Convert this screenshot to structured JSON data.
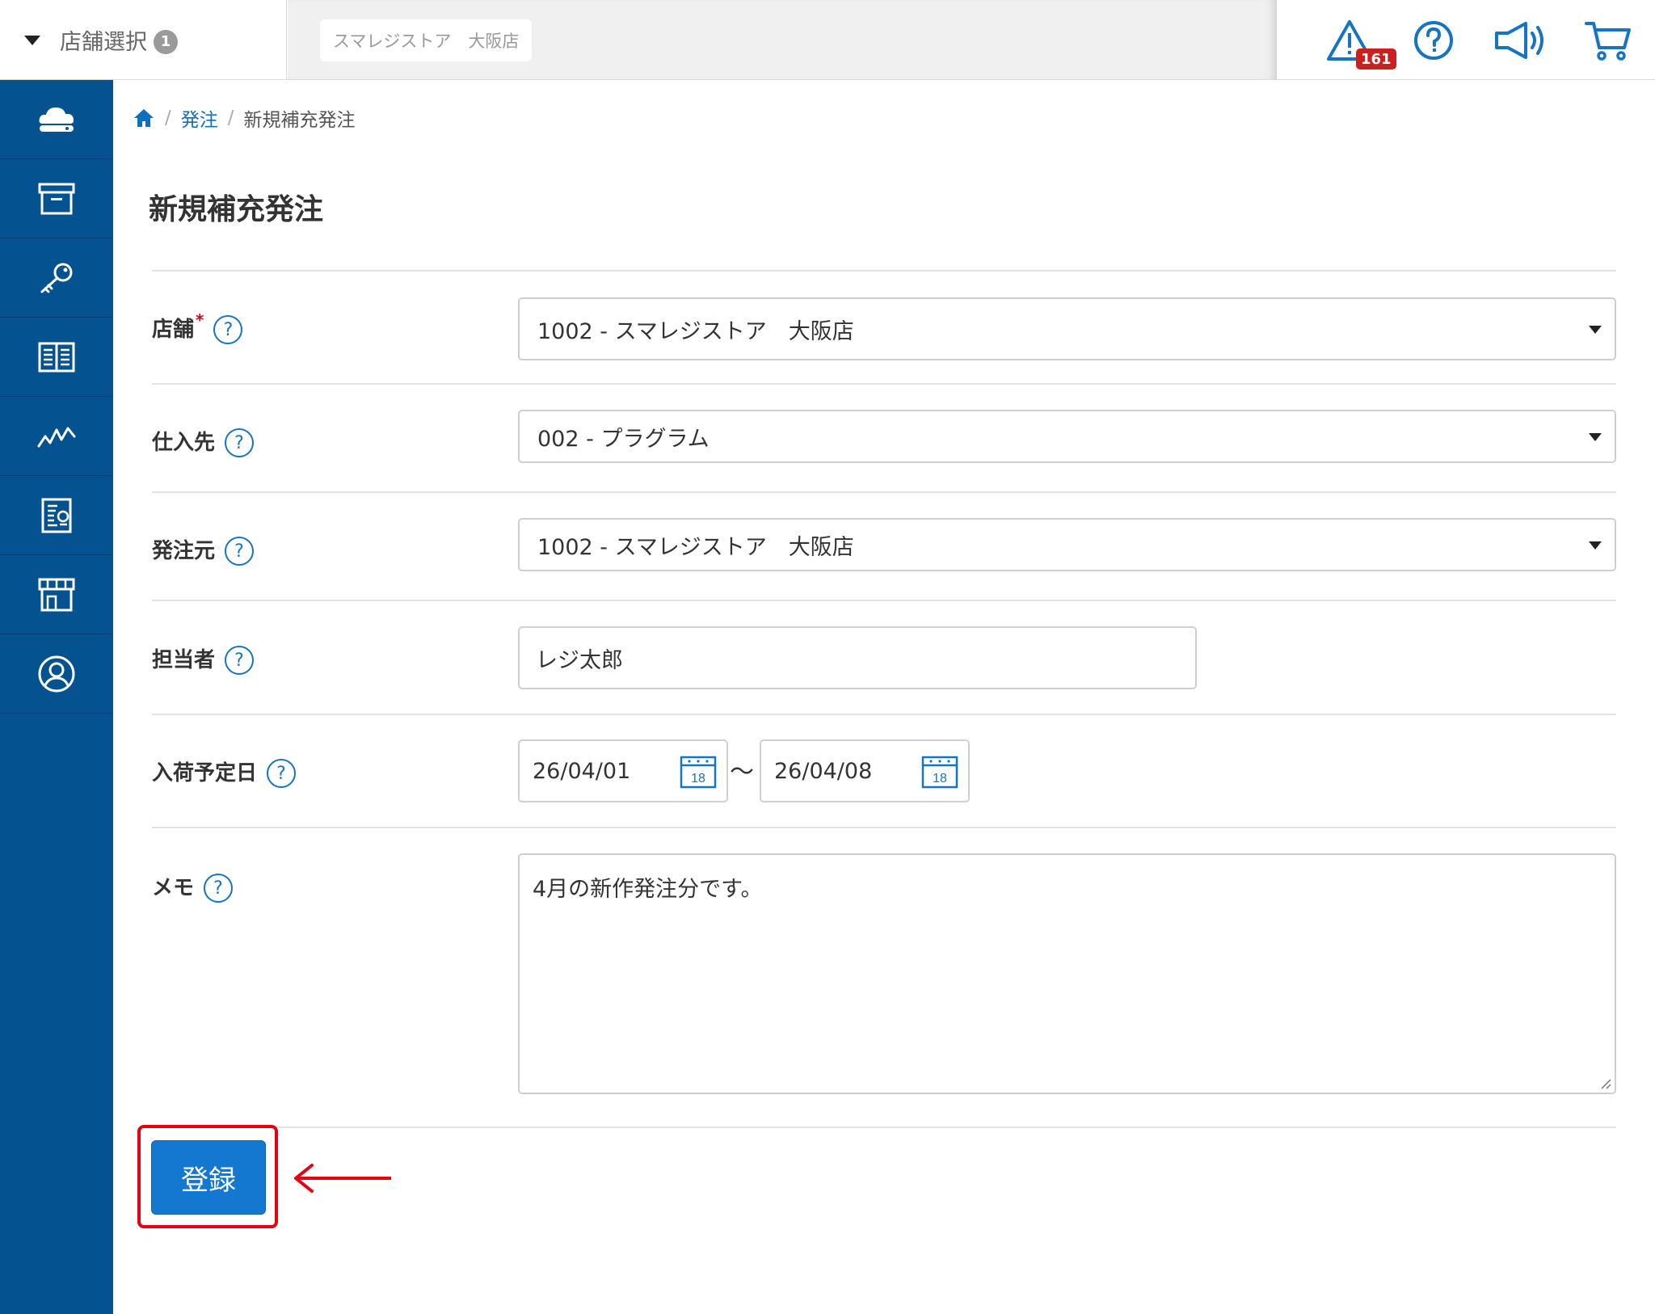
{
  "topbar": {
    "store_select_label": "店舗選択",
    "store_select_count": "1",
    "current_store": "スマレジストア　大阪店",
    "alert_badge": "161"
  },
  "icons": {
    "alert": "warning-triangle-icon",
    "help": "question-circle-icon",
    "announce": "megaphone-icon",
    "cart": "cart-icon"
  },
  "sidebar": {
    "items": [
      "cloud-icon",
      "archive-box-icon",
      "key-icon",
      "book-icon",
      "chart-line-icon",
      "report-icon",
      "store-icon",
      "user-circle-icon"
    ]
  },
  "breadcrumb": {
    "parent": "発注",
    "current": "新規補充発注"
  },
  "page": {
    "title": "新規補充発注"
  },
  "form": {
    "store": {
      "label": "店舗",
      "required_mark": "*",
      "value": "1002 - スマレジストア　大阪店"
    },
    "supplier": {
      "label": "仕入先",
      "value": "002 - プラグラム"
    },
    "origin": {
      "label": "発注元",
      "value": "1002 - スマレジストア　大阪店"
    },
    "staff": {
      "label": "担当者",
      "value": "レジ太郎"
    },
    "arrival": {
      "label": "入荷予定日",
      "from": "26/04/01",
      "to": "26/04/08",
      "separator": "〜",
      "calendar_day": "18"
    },
    "memo": {
      "label": "メモ",
      "value": "4月の新作発注分です。"
    },
    "help_glyph": "?",
    "submit_label": "登録"
  },
  "colors": {
    "sidebar": "#04528f",
    "accent": "#1574c4",
    "button": "#1578d0",
    "annotation": "#e60012",
    "badge": "#cc1f1f"
  }
}
